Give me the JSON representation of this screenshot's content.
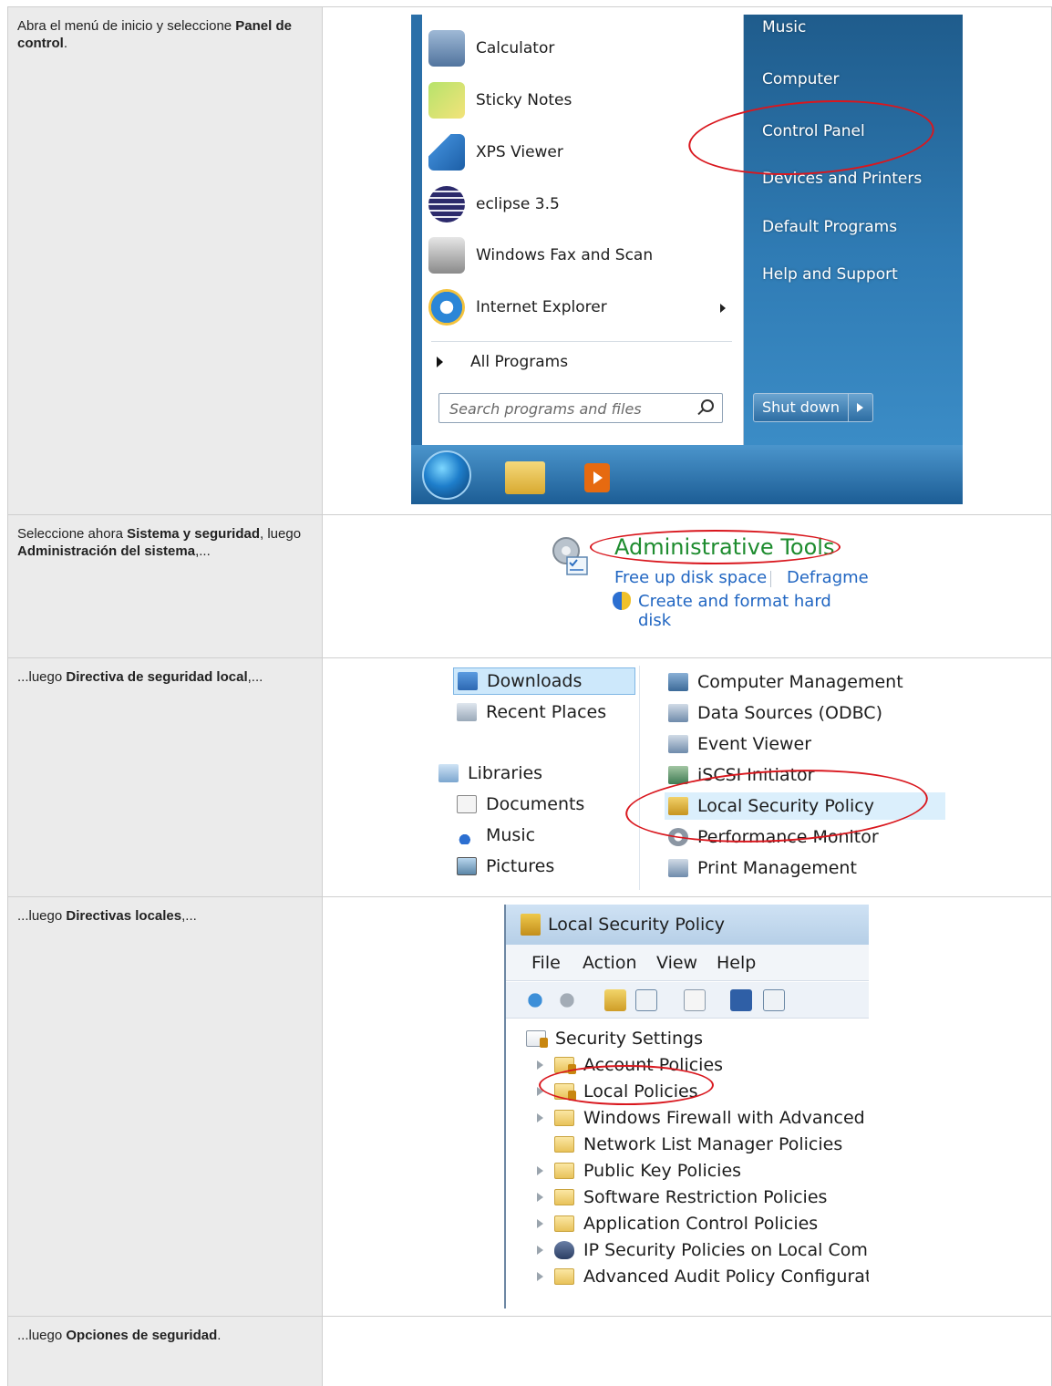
{
  "steps": [
    {
      "pre": "Abra el menú de inicio y seleccione ",
      "bold1": "Panel de control",
      "post": "."
    },
    {
      "pre": "Seleccione ahora ",
      "bold1": "Sistema y seguridad",
      "mid": ", luego ",
      "bold2": "Administración del sistema",
      "post": ",..."
    },
    {
      "pre": "...luego ",
      "bold1": "Directiva de seguridad local",
      "post": ",..."
    },
    {
      "pre": "...luego ",
      "bold1": "Directivas locales",
      "post": ",..."
    },
    {
      "pre": "...luego ",
      "bold1": "Opciones de seguridad",
      "post": "."
    }
  ],
  "start_menu": {
    "programs": [
      "Calculator",
      "Sticky Notes",
      "XPS Viewer",
      "eclipse 3.5",
      "Windows Fax and Scan",
      "Internet Explorer"
    ],
    "all_programs": "All Programs",
    "search_placeholder": "Search programs and files",
    "right_items": [
      "Music",
      "Computer",
      "Control Panel",
      "Devices and Printers",
      "Default Programs",
      "Help and Support"
    ],
    "shutdown": "Shut down"
  },
  "admin_tools": {
    "title": "Administrative Tools",
    "link1": "Free up disk space",
    "link2": "Defragme",
    "link3": "Create and format hard disk"
  },
  "explorer": {
    "nav": [
      "Downloads",
      "Recent Places",
      "Libraries",
      "Documents",
      "Music",
      "Pictures"
    ],
    "tools": [
      "Computer Management",
      "Data Sources (ODBC)",
      "Event Viewer",
      "iSCSI Initiator",
      "Local Security Policy",
      "Performance Monitor",
      "Print Management"
    ]
  },
  "lsp": {
    "title": "Local Security Policy",
    "menu": [
      "File",
      "Action",
      "View",
      "Help"
    ],
    "root": "Security Settings",
    "tree": [
      "Account Policies",
      "Local Policies",
      "Windows Firewall with Advanced Sec",
      "Network List Manager Policies",
      "Public Key Policies",
      "Software Restriction Policies",
      "Application Control Policies",
      "IP Security Policies on Local Comput",
      "Advanced Audit Policy Configuratior"
    ]
  },
  "colors": {
    "highlight_ellipse": "#d9171e",
    "admin_title": "#1e8c2f",
    "link": "#2166c2"
  }
}
